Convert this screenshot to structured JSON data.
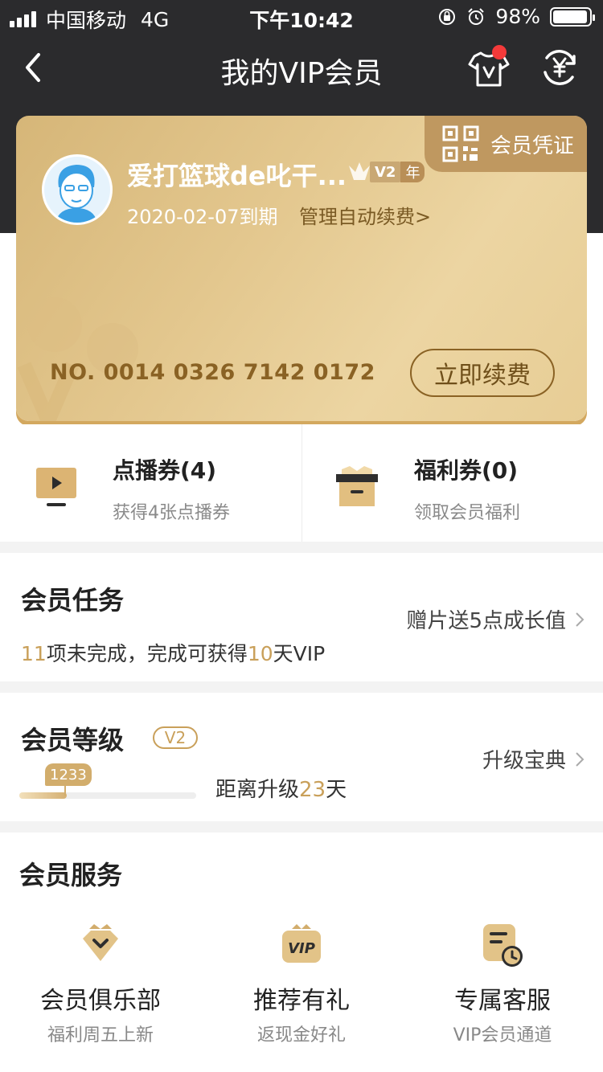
{
  "status_bar": {
    "carrier": "中国移动",
    "network": "4G",
    "time": "下午10:42",
    "battery": "98%"
  },
  "nav": {
    "title": "我的VIP会员"
  },
  "card": {
    "certificate_label": "会员凭证",
    "username": "爱打篮球de叱干...",
    "level_tag": "V2",
    "level_unit": "年",
    "expire": "2020-02-07到期",
    "manage_auto_renew": "管理自动续费>",
    "card_number": "NO. 0014 0326 7142 0172",
    "renew_button": "立即续费"
  },
  "coupons": [
    {
      "title": "点播券(4)",
      "subtitle": "获得4张点播券"
    },
    {
      "title": "福利券(0)",
      "subtitle": "领取会员福利"
    }
  ],
  "tasks": {
    "title": "会员任务",
    "right_link": "赠片送5点成长值",
    "incomplete_count": "11",
    "incomplete_text": "项未完成，完成可获得",
    "reward_days": "10",
    "reward_suffix": "天VIP"
  },
  "level": {
    "title": "会员等级",
    "badge": "V2",
    "right_link": "升级宝典",
    "points": "1233",
    "progress_fraction": 0.27,
    "remain_prefix": "距离升级",
    "remain_days": "23",
    "remain_suffix": "天"
  },
  "services": {
    "title": "会员服务",
    "items": [
      {
        "title": "会员俱乐部",
        "subtitle": "福利周五上新",
        "icon": "crown-diamond-icon"
      },
      {
        "title": "推荐有礼",
        "subtitle": "返现金好礼",
        "icon": "vip-icon"
      },
      {
        "title": "专属客服",
        "subtitle": "VIP会员通道",
        "icon": "service-clock-icon"
      }
    ]
  },
  "colors": {
    "header_bg": "#2b2b2d",
    "gold_accent": "#c9a05a",
    "card_gold": "#e3c78e",
    "notification_dot": "#f43a3a"
  }
}
